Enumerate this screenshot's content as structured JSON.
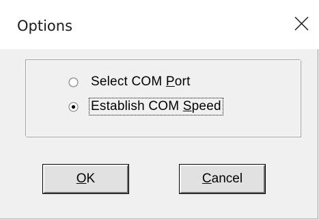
{
  "window": {
    "title": "Options",
    "close_icon": "close-icon"
  },
  "options_group": {
    "radios": [
      {
        "label_pre": "Select COM ",
        "mnemonic": "P",
        "label_post": "ort",
        "selected": false
      },
      {
        "label_pre": "Establish COM ",
        "mnemonic": "S",
        "label_post": "peed",
        "selected": true
      }
    ]
  },
  "buttons": {
    "ok": {
      "mnemonic": "O",
      "rest": "K"
    },
    "cancel": {
      "mnemonic": "C",
      "rest": "ancel"
    }
  }
}
